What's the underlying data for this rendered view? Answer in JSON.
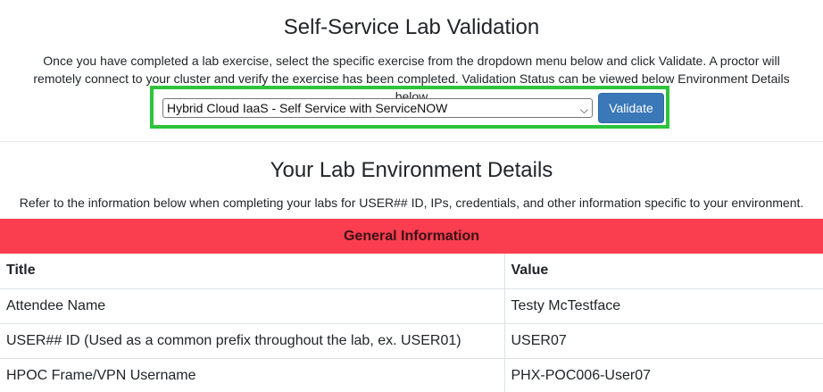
{
  "validation": {
    "title": "Self-Service Lab Validation",
    "intro": "Once you have completed a lab exercise, select the specific exercise from the dropdown menu below and click Validate. A proctor will remotely connect to your cluster and verify the exercise has been completed. Validation Status can be viewed below Environment Details below",
    "selected_exercise": "Hybrid Cloud IaaS - Self Service with ServiceNOW",
    "validate_label": "Validate"
  },
  "environment": {
    "title": "Your Lab Environment Details",
    "subtitle": "Refer to the information below when completing your labs for USER## ID, IPs, credentials, and other information specific to your environment."
  },
  "table": {
    "group_title": "General Information",
    "headers": {
      "title": "Title",
      "value": "Value"
    },
    "rows": [
      {
        "title": "Attendee Name",
        "value": "Testy McTestface"
      },
      {
        "title": "USER## ID (Used as a common prefix throughout the lab, ex. USER01)",
        "value": "USER07"
      },
      {
        "title": "HPOC Frame/VPN Username",
        "value": "PHX-POC006-User07"
      }
    ]
  },
  "colors": {
    "highlight_border": "#2dc43c",
    "group_header_bg": "#fa3d4f",
    "button_bg": "#3a78b8"
  }
}
